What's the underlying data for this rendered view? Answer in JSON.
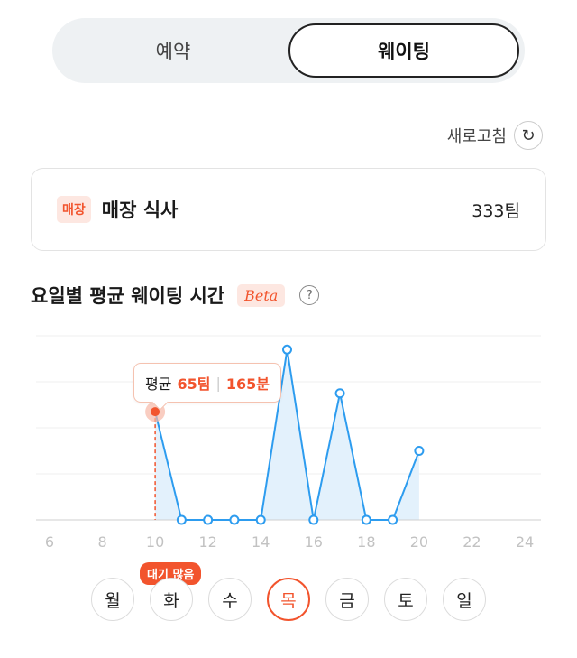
{
  "tabs": {
    "reservation": "예약",
    "waiting": "웨이팅"
  },
  "refresh": {
    "label": "새로고침",
    "icon": "refresh-icon"
  },
  "card": {
    "badge": "매장",
    "title": "매장 식사",
    "count": "333팀"
  },
  "section": {
    "title": "요일별 평균 웨이팅 시간",
    "beta": "Beta",
    "help_icon": "question-icon"
  },
  "tooltip": {
    "prefix": "평균",
    "teams": "65팀",
    "sep": "|",
    "minutes": "165분"
  },
  "chart_data": {
    "type": "line",
    "x": [
      10,
      11,
      12,
      13,
      14,
      15,
      16,
      17,
      18,
      19,
      20
    ],
    "values": [
      4.7,
      0,
      0,
      0,
      0,
      7.4,
      0,
      5.5,
      0,
      0,
      3.0
    ],
    "x_ticks": [
      6,
      8,
      10,
      12,
      14,
      16,
      18,
      20,
      22,
      24
    ],
    "xlim": [
      6,
      24
    ],
    "ylim": [
      0,
      8
    ],
    "grid": true,
    "highlight_x": 10,
    "colors": {
      "line": "#2d9cef",
      "fill": "#e3f1fc",
      "highlight": "#f2542d"
    }
  },
  "busy_badge": "대기 많음",
  "days": [
    "월",
    "화",
    "수",
    "목",
    "금",
    "토",
    "일"
  ],
  "active_day": "목"
}
